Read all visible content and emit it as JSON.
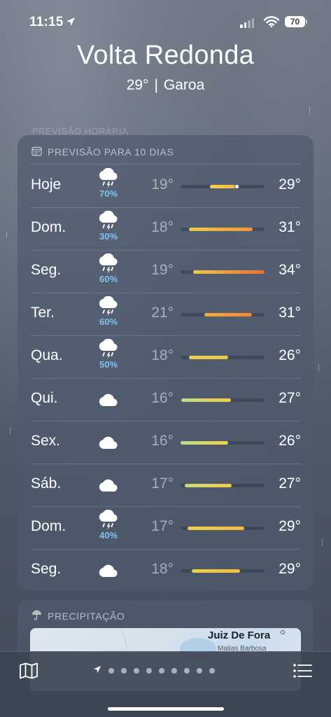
{
  "status_bar": {
    "time": "11:15",
    "battery": "70",
    "location_icon": "location-arrow-icon",
    "signal_icon": "cellular-signal-icon",
    "wifi_icon": "wifi-icon"
  },
  "header": {
    "city": "Volta Redonda",
    "temperature": "29°",
    "separator": "|",
    "condition": "Garoa",
    "hidden_section_label": "PREVISÃO HORÁRIA"
  },
  "forecast": {
    "title": "PREVISÃO PARA 10 DIAS",
    "title_icon": "calendar-icon",
    "days": [
      {
        "day": "Hoje",
        "icon": "cloud-bolt-rain-icon",
        "precip": "70%",
        "low": "19°",
        "high": "29°",
        "bar": [
          0.35,
          0.68
        ],
        "colors": [
          "#f2d24c",
          "#f7b437"
        ],
        "now": 0.67
      },
      {
        "day": "Dom.",
        "icon": "cloud-bolt-rain-icon",
        "precip": "30%",
        "low": "18°",
        "high": "31°",
        "bar": [
          0.1,
          0.86
        ],
        "colors": [
          "#eccb48",
          "#f4923a"
        ]
      },
      {
        "day": "Seg.",
        "icon": "cloud-bolt-rain-icon",
        "precip": "60%",
        "low": "19°",
        "high": "34°",
        "bar": [
          0.15,
          1.0
        ],
        "colors": [
          "#f0c844",
          "#ee6a3a"
        ]
      },
      {
        "day": "Ter.",
        "icon": "cloud-bolt-rain-icon",
        "precip": "60%",
        "low": "21°",
        "high": "31°",
        "bar": [
          0.28,
          0.85
        ],
        "colors": [
          "#f2aa3e",
          "#f1843a"
        ]
      },
      {
        "day": "Qua.",
        "icon": "cloud-bolt-rain-icon",
        "precip": "50%",
        "low": "18°",
        "high": "26°",
        "bar": [
          0.1,
          0.57
        ],
        "colors": [
          "#ead14c",
          "#f2c446"
        ]
      },
      {
        "day": "Qui.",
        "icon": "cloud-icon",
        "precip": "",
        "low": "16°",
        "high": "27°",
        "bar": [
          0.01,
          0.6
        ],
        "colors": [
          "#bfd98c",
          "#f2cc48"
        ]
      },
      {
        "day": "Sex.",
        "icon": "cloud-icon",
        "precip": "",
        "low": "16°",
        "high": "26°",
        "bar": [
          0.0,
          0.57
        ],
        "colors": [
          "#bfd98c",
          "#f0d04a"
        ]
      },
      {
        "day": "Sáb.",
        "icon": "cloud-icon",
        "precip": "",
        "low": "17°",
        "high": "27°",
        "bar": [
          0.05,
          0.61
        ],
        "colors": [
          "#cfda7a",
          "#f2cc48"
        ]
      },
      {
        "day": "Dom.",
        "icon": "cloud-bolt-rain-icon",
        "precip": "40%",
        "low": "17°",
        "high": "29°",
        "bar": [
          0.08,
          0.76
        ],
        "colors": [
          "#e6d44c",
          "#f5b83e"
        ]
      },
      {
        "day": "Seg.",
        "icon": "cloud-icon",
        "precip": "",
        "low": "18°",
        "high": "29°",
        "bar": [
          0.13,
          0.71
        ],
        "colors": [
          "#eed04a",
          "#f4bc40"
        ]
      }
    ]
  },
  "precipitation": {
    "title": "PRECIPITAÇÃO",
    "title_icon": "umbrella-icon",
    "map_city": "Juiz De Fora",
    "map_city2": "Matias Barbosa"
  },
  "toolbar": {
    "map_icon": "map-icon",
    "list_icon": "list-icon",
    "page_dots": 9
  }
}
